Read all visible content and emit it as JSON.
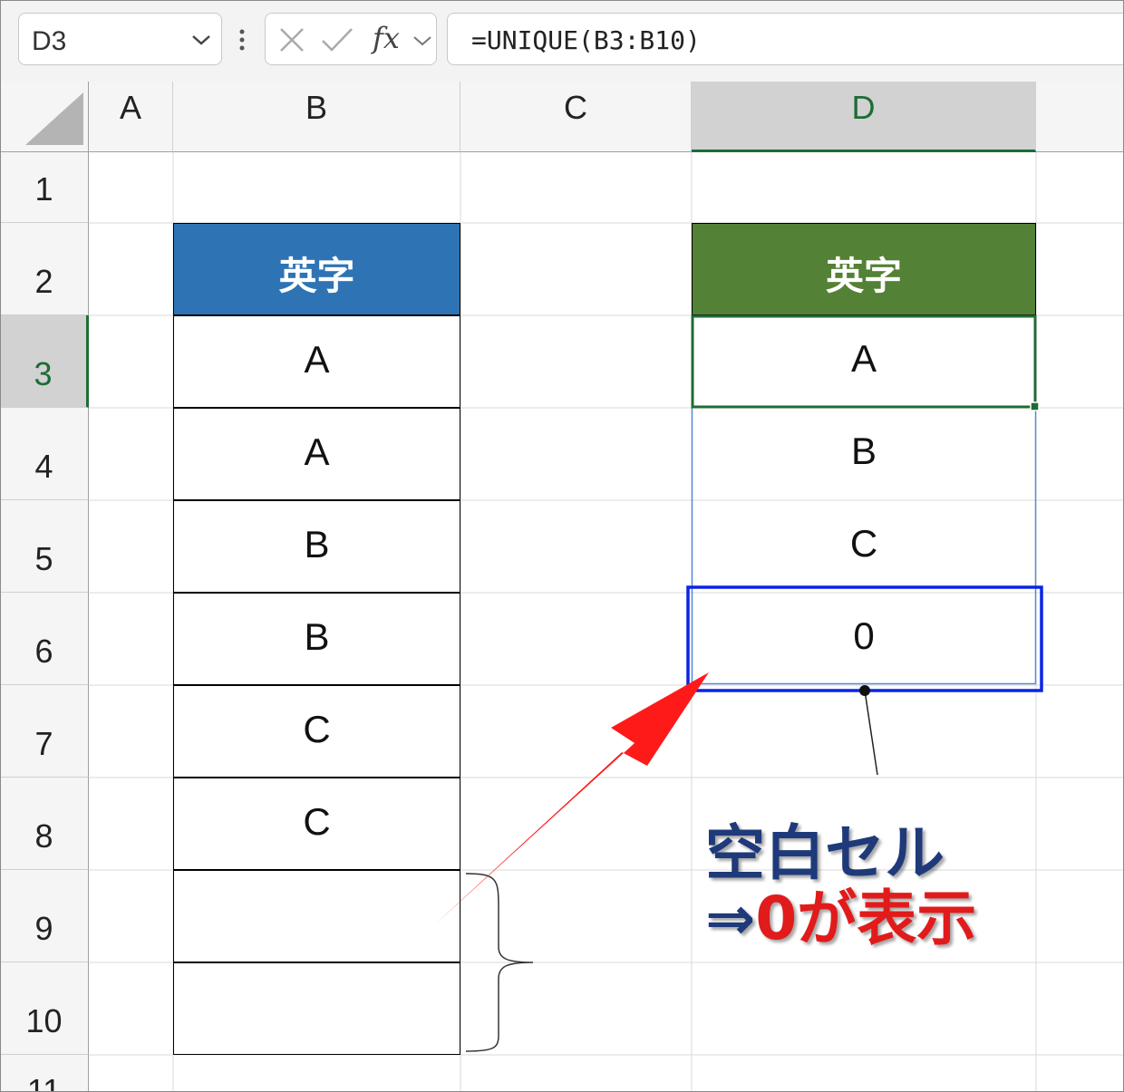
{
  "formula_bar": {
    "name_box": "D3",
    "fx_label": "fx",
    "formula": "=UNIQUE(B3:B10)"
  },
  "columns": [
    "A",
    "B",
    "C",
    "D"
  ],
  "rows": [
    "1",
    "2",
    "3",
    "4",
    "5",
    "6",
    "7",
    "8",
    "9",
    "10",
    "11"
  ],
  "selected_cell": "D3",
  "source_table": {
    "header": "英字",
    "header_color": "#2e74b5",
    "values": [
      "A",
      "A",
      "B",
      "B",
      "C",
      "C",
      "",
      ""
    ]
  },
  "result_table": {
    "header": "英字",
    "header_color": "#538135",
    "values": [
      "A",
      "B",
      "C",
      "0"
    ]
  },
  "annotation": {
    "line1": "空白セル",
    "line2_prefix": "⇒",
    "line2_highlight": "0が表示",
    "highlight_color": "#e11b1b",
    "text_color": "#1f3a7a"
  }
}
